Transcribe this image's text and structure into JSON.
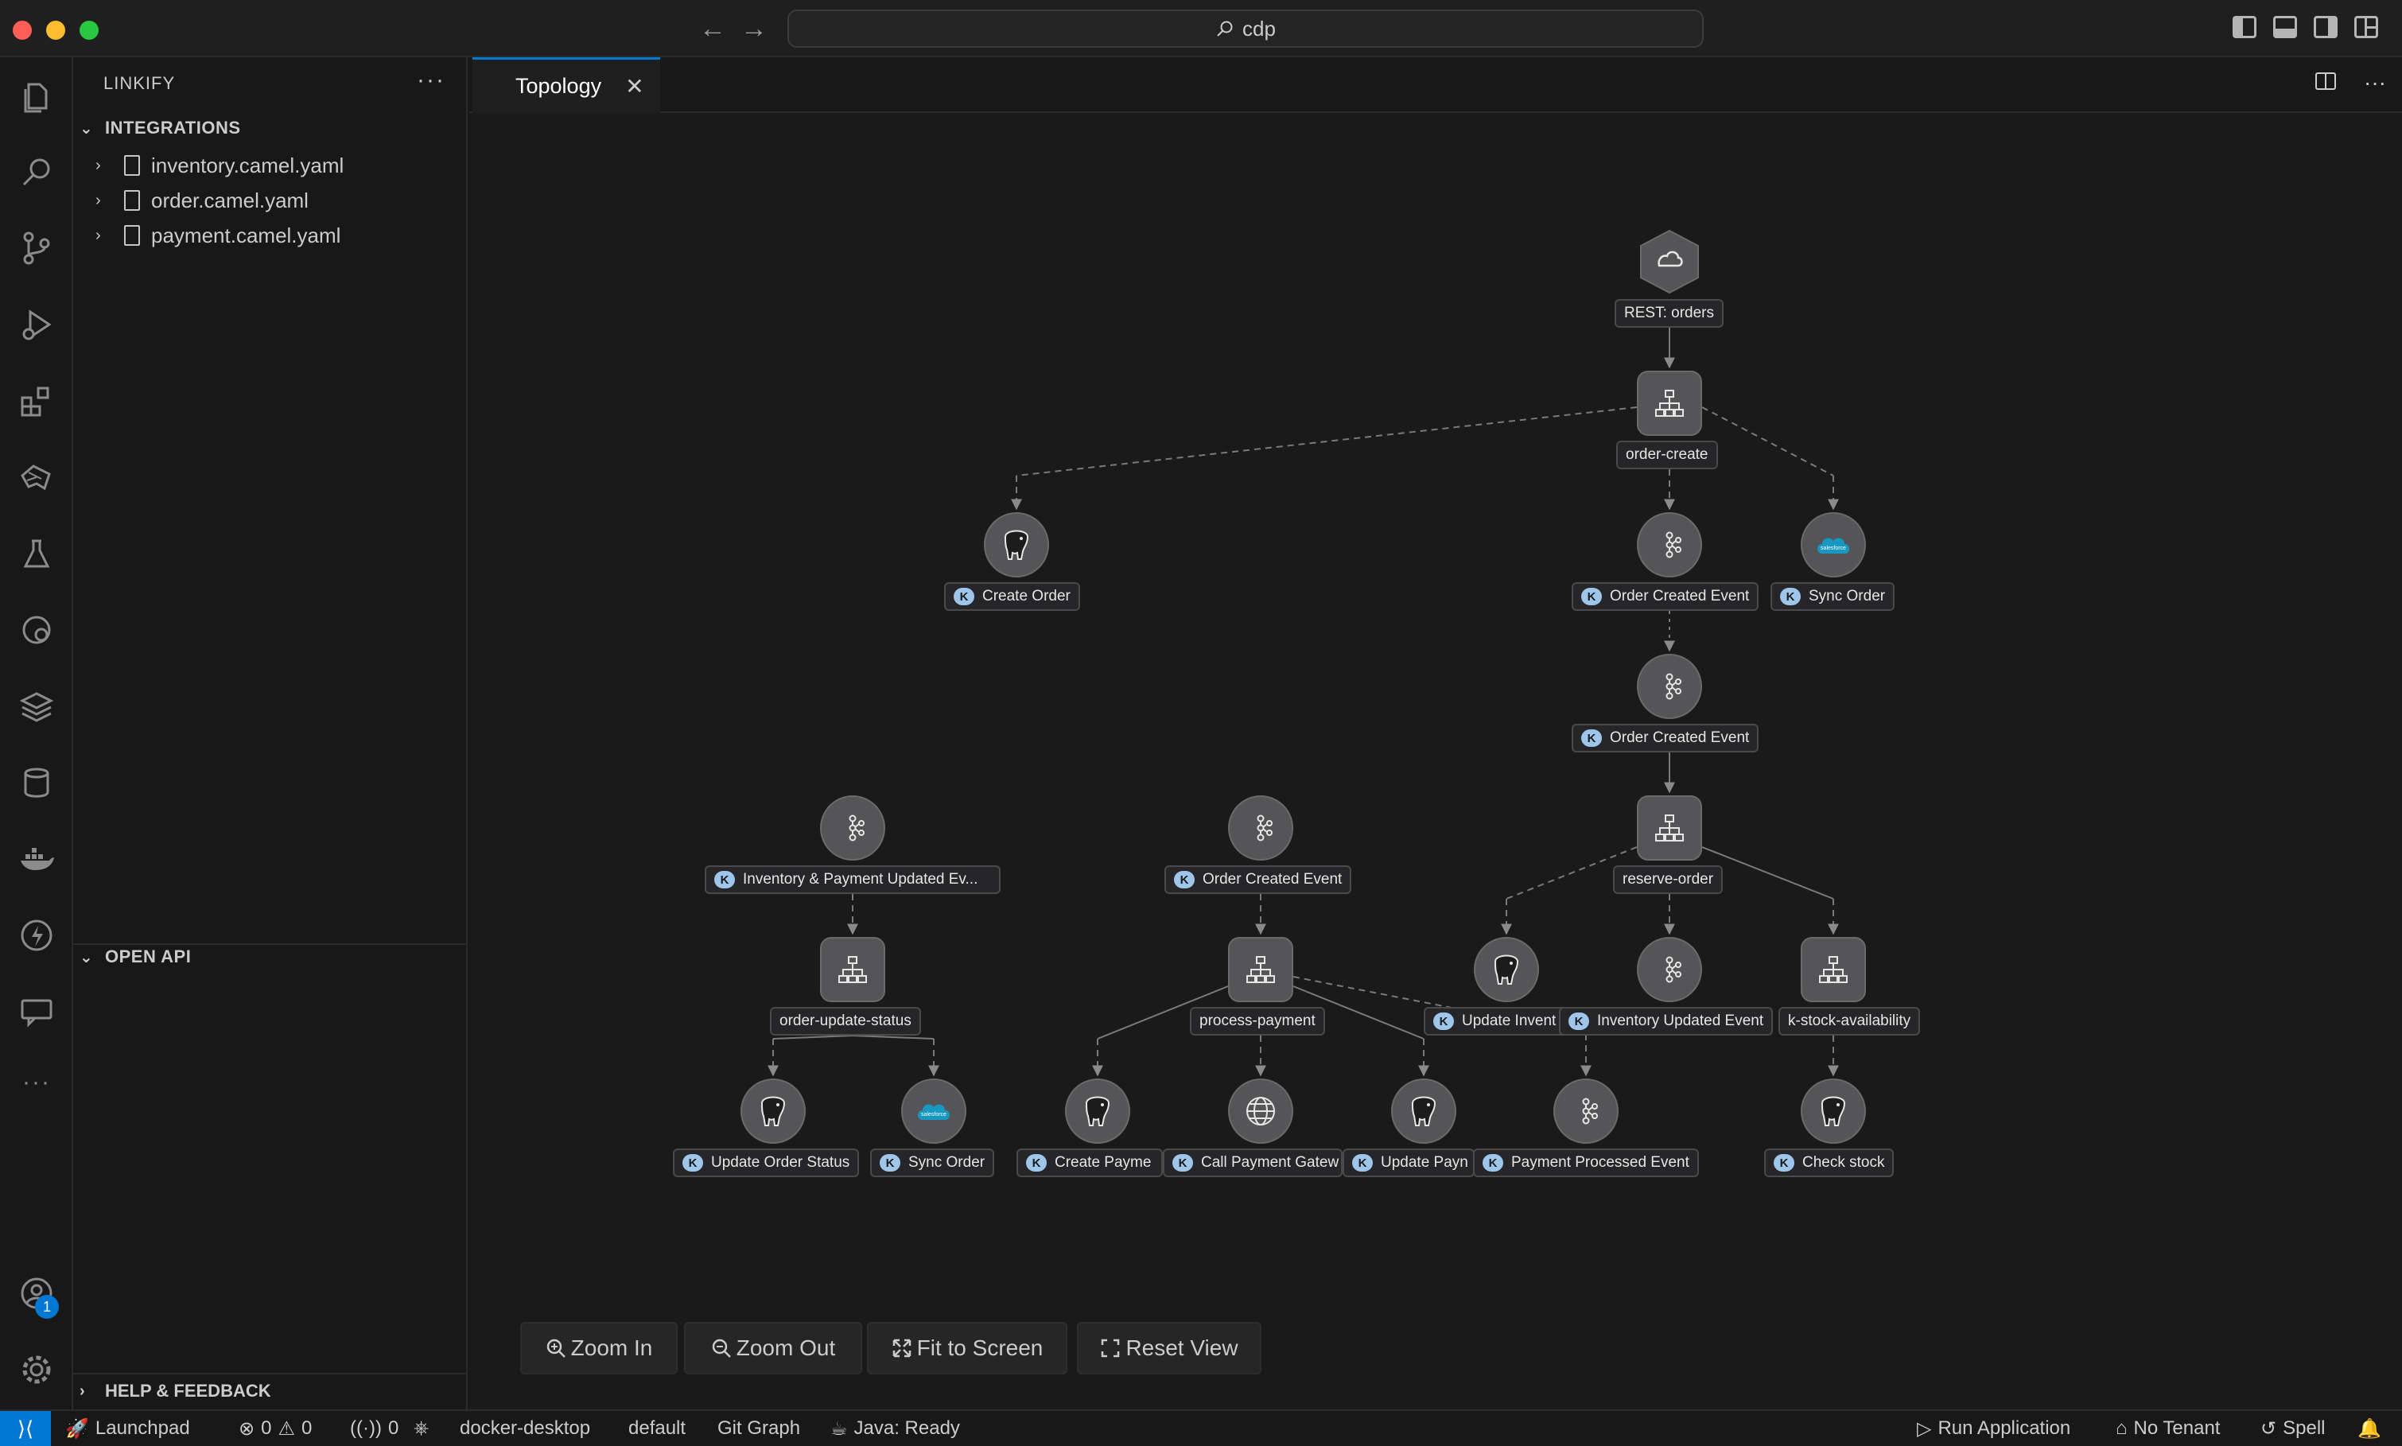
{
  "titlebar": {
    "back_arrow": "←",
    "forward_arrow": "→",
    "search_text": "cdp"
  },
  "sidebar": {
    "title": "LINKIFY",
    "more": "···",
    "integrations": {
      "header": "INTEGRATIONS",
      "files": [
        "inventory.camel.yaml",
        "order.camel.yaml",
        "payment.camel.yaml"
      ]
    },
    "openapi": {
      "header": "OPEN API"
    },
    "help": {
      "header": "HELP & FEEDBACK"
    }
  },
  "activity_bar": {
    "accounts_badge": "1",
    "more": "···"
  },
  "editor": {
    "tab_label": "Topology",
    "tab_close": "✕",
    "actions_more": "···"
  },
  "graph": {
    "nodes": {
      "rest_orders": "REST: orders",
      "order_create": "order-create",
      "create_order": "Create Order",
      "order_created_event_1": "Order Created Event",
      "sync_order_1": "Sync Order",
      "order_created_event_2": "Order Created Event",
      "reserve_order": "reserve-order",
      "inventory_payment_event": "Inventory & Payment Updated Ev...",
      "order_created_event_3": "Order Created Event",
      "order_update_status": "order-update-status",
      "process_payment": "process-payment",
      "update_inventory": "Update Invent",
      "inventory_updated_event": "Inventory Updated Event",
      "check_stock_availability": "k-stock-availability",
      "update_order_status": "Update Order Status",
      "sync_order_2": "Sync Order",
      "create_payment": "Create Payme",
      "call_payment_gateway": "Call Payment Gatew",
      "update_payment": "Update Payn",
      "payment_processed_event": "Payment Processed Event",
      "check_stock": "Check stock"
    },
    "kamelet_badge": "K",
    "salesforce_text": "salesforce"
  },
  "zoom": {
    "zoom_in": "Zoom In",
    "zoom_out": "Zoom Out",
    "fit": "Fit to Screen",
    "reset": "Reset View"
  },
  "statusbar": {
    "launchpad": "Launchpad",
    "errors": "0",
    "warnings": "0",
    "ports": "0",
    "context": "docker-desktop",
    "namespace": "default",
    "git_graph": "Git Graph",
    "java": "Java: Ready",
    "run_app": "Run Application",
    "tenant": "No Tenant",
    "spell": "Spell"
  },
  "colors": {
    "accent": "#0078d4",
    "background": "#181818",
    "canvas": "#1a1a1b",
    "node_fill": "#555557",
    "kamelet_badge": "#9ec5ea",
    "salesforce_blue": "#1798c1"
  }
}
